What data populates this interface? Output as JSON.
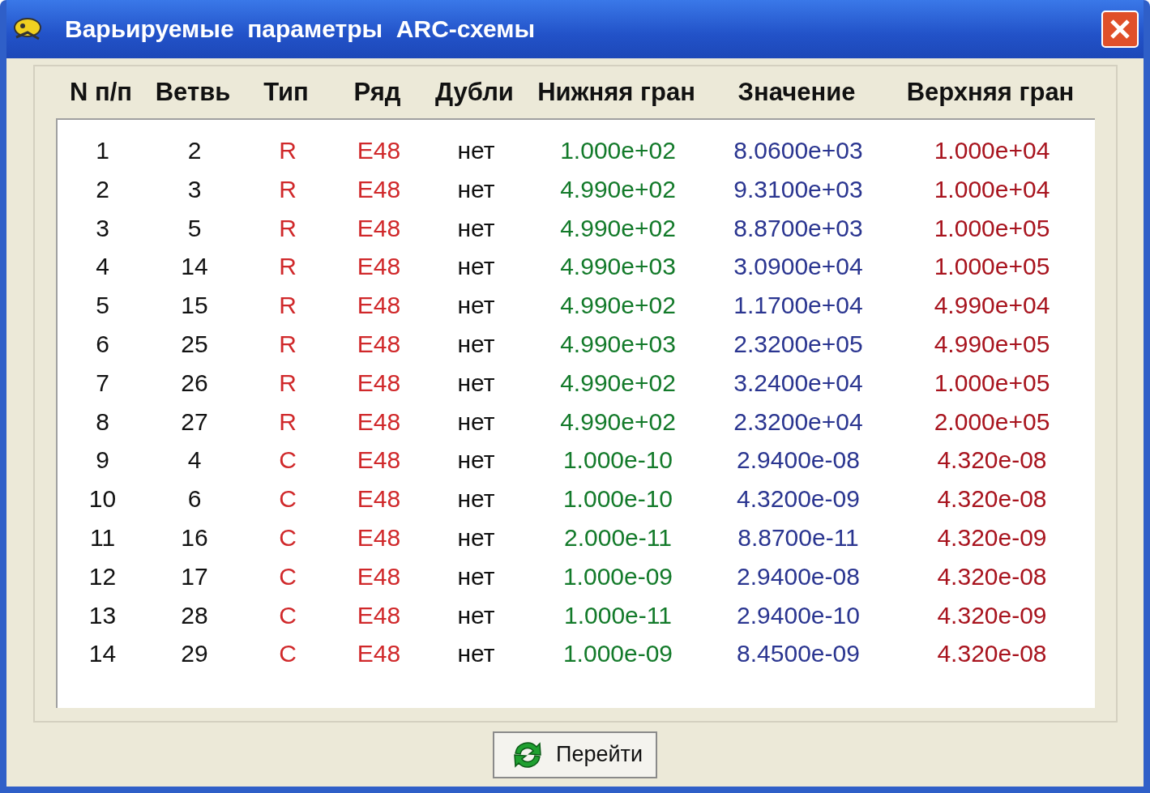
{
  "window": {
    "title": "Варьируемые  параметры  ARC-схемы"
  },
  "table": {
    "columns": [
      "N п/п",
      "Ветвь",
      "Тип",
      "Ряд",
      "Дубли",
      "Нижняя гран",
      "Значение",
      "Верхняя гран"
    ],
    "rows": [
      {
        "n": "1",
        "branch": "2",
        "type": "R",
        "series": "E48",
        "duplicates": "нет",
        "lower": "1.000e+02",
        "value": "8.0600e+03",
        "upper": "1.000e+04"
      },
      {
        "n": "2",
        "branch": "3",
        "type": "R",
        "series": "E48",
        "duplicates": "нет",
        "lower": "4.990e+02",
        "value": "9.3100e+03",
        "upper": "1.000e+04"
      },
      {
        "n": "3",
        "branch": "5",
        "type": "R",
        "series": "E48",
        "duplicates": "нет",
        "lower": "4.990e+02",
        "value": "8.8700e+03",
        "upper": "1.000e+05"
      },
      {
        "n": "4",
        "branch": "14",
        "type": "R",
        "series": "E48",
        "duplicates": "нет",
        "lower": "4.990e+03",
        "value": "3.0900e+04",
        "upper": "1.000e+05"
      },
      {
        "n": "5",
        "branch": "15",
        "type": "R",
        "series": "E48",
        "duplicates": "нет",
        "lower": "4.990e+02",
        "value": "1.1700e+04",
        "upper": "4.990e+04"
      },
      {
        "n": "6",
        "branch": "25",
        "type": "R",
        "series": "E48",
        "duplicates": "нет",
        "lower": "4.990e+03",
        "value": "2.3200e+05",
        "upper": "4.990e+05"
      },
      {
        "n": "7",
        "branch": "26",
        "type": "R",
        "series": "E48",
        "duplicates": "нет",
        "lower": "4.990e+02",
        "value": "3.2400e+04",
        "upper": "1.000e+05"
      },
      {
        "n": "8",
        "branch": "27",
        "type": "R",
        "series": "E48",
        "duplicates": "нет",
        "lower": "4.990e+02",
        "value": "2.3200e+04",
        "upper": "2.000e+05"
      },
      {
        "n": "9",
        "branch": "4",
        "type": "C",
        "series": "E48",
        "duplicates": "нет",
        "lower": "1.000e-10",
        "value": "2.9400e-08",
        "upper": "4.320e-08"
      },
      {
        "n": "10",
        "branch": "6",
        "type": "C",
        "series": "E48",
        "duplicates": "нет",
        "lower": "1.000e-10",
        "value": "4.3200e-09",
        "upper": "4.320e-08"
      },
      {
        "n": "11",
        "branch": "16",
        "type": "C",
        "series": "E48",
        "duplicates": "нет",
        "lower": "2.000e-11",
        "value": "8.8700e-11",
        "upper": "4.320e-09"
      },
      {
        "n": "12",
        "branch": "17",
        "type": "C",
        "series": "E48",
        "duplicates": "нет",
        "lower": "1.000e-09",
        "value": "2.9400e-08",
        "upper": "4.320e-08"
      },
      {
        "n": "13",
        "branch": "28",
        "type": "C",
        "series": "E48",
        "duplicates": "нет",
        "lower": "1.000e-11",
        "value": "2.9400e-10",
        "upper": "4.320e-09"
      },
      {
        "n": "14",
        "branch": "29",
        "type": "C",
        "series": "E48",
        "duplicates": "нет",
        "lower": "1.000e-09",
        "value": "8.4500e-09",
        "upper": "4.320e-08"
      }
    ]
  },
  "button": {
    "label": "Перейти"
  }
}
